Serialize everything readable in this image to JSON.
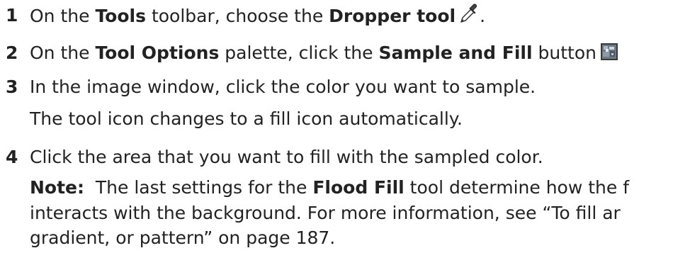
{
  "steps": [
    {
      "number": "1",
      "parts": [
        "On the ",
        "Tools",
        " toolbar, choose the ",
        "Dropper tool",
        "."
      ],
      "icon": "dropper-icon"
    },
    {
      "number": "2",
      "parts": [
        "On the ",
        "Tool Options",
        " palette, click the ",
        "Sample and Fill",
        " button"
      ],
      "icon": "sample-and-fill-button-icon"
    },
    {
      "number": "3",
      "text": "In the image window, click the color you want to sample.",
      "followup": "The tool icon changes to a fill icon automatically."
    },
    {
      "number": "4",
      "text": "Click the area that you want to fill with the sampled color.",
      "note": {
        "label": "Note:",
        "parts": [
          "  The last settings for the ",
          "Flood Fill",
          " tool determine how the f",
          "interacts with the background. For more information, see “To fill ar",
          "gradient, or pattern” on page 187."
        ]
      }
    }
  ]
}
